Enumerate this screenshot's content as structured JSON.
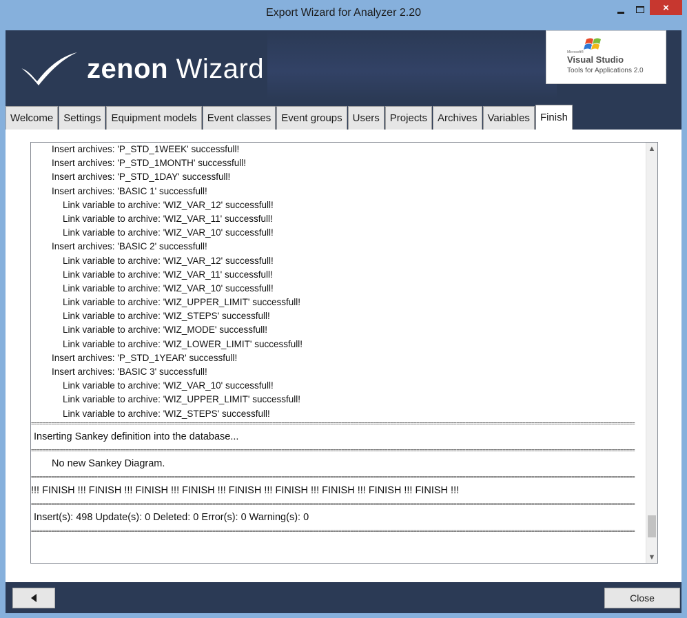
{
  "window": {
    "title": "Export Wizard for Analyzer 2.20",
    "close_glyph": "×",
    "minimize_icon": "minimize-icon",
    "maximize_icon": "maximize-icon"
  },
  "banner": {
    "brand_bold": "zenon",
    "brand_rest": " Wizard",
    "vs_microsoft": "Microsoft®",
    "vs_title": "Visual Studio",
    "vs_subtitle": "Tools for Applications 2.0"
  },
  "tabs": [
    {
      "label": "Welcome"
    },
    {
      "label": "Settings"
    },
    {
      "label": "Equipment models"
    },
    {
      "label": "Event classes"
    },
    {
      "label": "Event groups"
    },
    {
      "label": "Users"
    },
    {
      "label": "Projects"
    },
    {
      "label": "Archives"
    },
    {
      "label": "Variables"
    },
    {
      "label": "Finish"
    }
  ],
  "log": {
    "entries": [
      "Insert archives: 'P_STD_1WEEK' successfull!",
      "Insert archives: 'P_STD_1MONTH' successfull!",
      "Insert archives: 'P_STD_1DAY' successfull!",
      "Insert archives: 'BASIC 1' successfull!",
      "Link variable to archive: 'WIZ_VAR_12' successfull!",
      "Link variable to archive: 'WIZ_VAR_11' successfull!",
      "Link variable to archive: 'WIZ_VAR_10' successfull!",
      "Insert archives: 'BASIC 2' successfull!",
      "Link variable to archive: 'WIZ_VAR_12' successfull!",
      "Link variable to archive: 'WIZ_VAR_11' successfull!",
      "Link variable to archive: 'WIZ_VAR_10' successfull!",
      "Link variable to archive: 'WIZ_UPPER_LIMIT' successfull!",
      "Link variable to archive: 'WIZ_STEPS' successfull!",
      "Link variable to archive: 'WIZ_MODE' successfull!",
      "Link variable to archive: 'WIZ_LOWER_LIMIT' successfull!",
      "Insert archives: 'P_STD_1YEAR' successfull!",
      "Insert archives: 'BASIC 3' successfull!",
      "Link variable to archive: 'WIZ_VAR_10' successfull!",
      "Link variable to archive: 'WIZ_UPPER_LIMIT' successfull!",
      "Link variable to archive: 'WIZ_STEPS' successfull!"
    ],
    "separator": "==================================================================================================================================================================================================================",
    "sankey_inserting": "Inserting Sankey definition into the database...",
    "sankey_result": "No new Sankey Diagram.",
    "finish_banner": "!!! FINISH !!! FINISH !!! FINISH !!! FINISH !!! FINISH !!! FINISH !!! FINISH !!! FINISH !!! FINISH !!!",
    "summary": "Insert(s): 498  Update(s): 0  Deleted: 0  Error(s): 0  Warning(s): 0"
  },
  "footer": {
    "back_icon": "back-arrow-icon",
    "close_label": "Close"
  }
}
